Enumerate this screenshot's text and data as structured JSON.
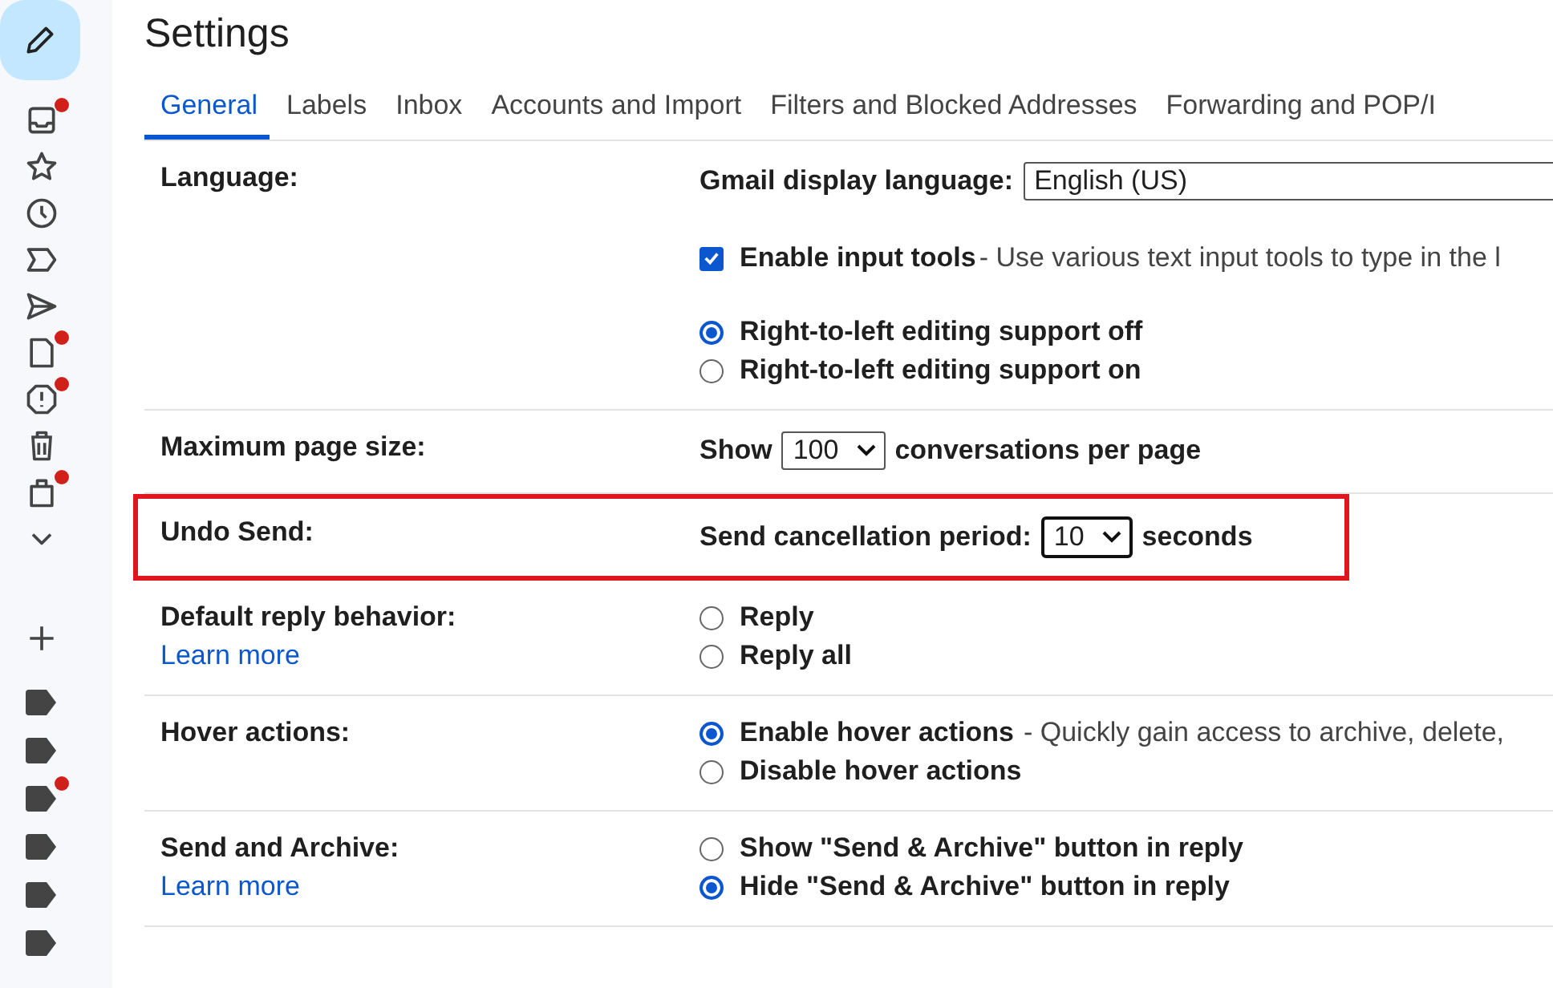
{
  "sidebar": {
    "items": [
      {
        "kind": "inbox",
        "badge": true
      },
      {
        "kind": "star",
        "badge": false
      },
      {
        "kind": "clock",
        "badge": false
      },
      {
        "kind": "important",
        "badge": false
      },
      {
        "kind": "send",
        "badge": false
      },
      {
        "kind": "draft",
        "badge": true
      },
      {
        "kind": "spam",
        "badge": true
      },
      {
        "kind": "trash",
        "badge": false
      },
      {
        "kind": "bag",
        "badge": true
      },
      {
        "kind": "more",
        "badge": false
      }
    ],
    "labels": [
      {
        "badge": false
      },
      {
        "badge": false
      },
      {
        "badge": true
      },
      {
        "badge": false
      },
      {
        "badge": false
      },
      {
        "badge": false
      }
    ]
  },
  "title": "Settings",
  "tabs": [
    {
      "label": "General",
      "selected": true
    },
    {
      "label": "Labels",
      "selected": false
    },
    {
      "label": "Inbox",
      "selected": false
    },
    {
      "label": "Accounts and Import",
      "selected": false
    },
    {
      "label": "Filters and Blocked Addresses",
      "selected": false
    },
    {
      "label": "Forwarding and POP/I",
      "selected": false
    }
  ],
  "rows": [
    {
      "label": "Language:",
      "highlighted": false,
      "groups": [
        [
          {
            "kind": "select",
            "prefix": "Gmail display language:",
            "value": "English (US)",
            "wide": true
          }
        ],
        [
          {
            "kind": "checkbox",
            "label": "Enable input tools",
            "description": "- Use various text input tools to type in the l",
            "checked": true
          }
        ],
        [
          {
            "kind": "radio",
            "label": "Right-to-left editing support off",
            "selected": true
          },
          {
            "kind": "radio",
            "label": "Right-to-left editing support on",
            "selected": false
          }
        ]
      ]
    },
    {
      "label": "Maximum page size:",
      "highlighted": false,
      "groups": [
        [
          {
            "kind": "select",
            "prefix": "Show",
            "value": "100",
            "wide": false,
            "suffix": "conversations per page"
          }
        ]
      ]
    },
    {
      "label": "Undo Send:",
      "highlighted": true,
      "groups": [
        [
          {
            "kind": "select",
            "prefix": "Send cancellation period:",
            "value": "10",
            "wide": false,
            "suffix": "seconds"
          }
        ]
      ]
    },
    {
      "label": "Default reply behavior:",
      "link": "Learn more",
      "highlighted": false,
      "groups": [
        [
          {
            "kind": "radio",
            "label": "Reply",
            "selected": false
          },
          {
            "kind": "radio",
            "label": "Reply all",
            "selected": false
          }
        ]
      ]
    },
    {
      "label": "Hover actions:",
      "highlighted": false,
      "groups": [
        [
          {
            "kind": "radio",
            "label": "Enable hover actions",
            "description": "- Quickly gain access to archive, delete,",
            "selected": true
          },
          {
            "kind": "radio",
            "label": "Disable hover actions",
            "selected": false
          }
        ]
      ]
    },
    {
      "label": "Send and Archive:",
      "link": "Learn more",
      "highlighted": false,
      "groups": [
        [
          {
            "kind": "radio",
            "label": "Show \"Send & Archive\" button in reply",
            "selected": false
          },
          {
            "kind": "radio",
            "label": "Hide \"Send & Archive\" button in reply",
            "selected": true
          }
        ]
      ]
    }
  ]
}
